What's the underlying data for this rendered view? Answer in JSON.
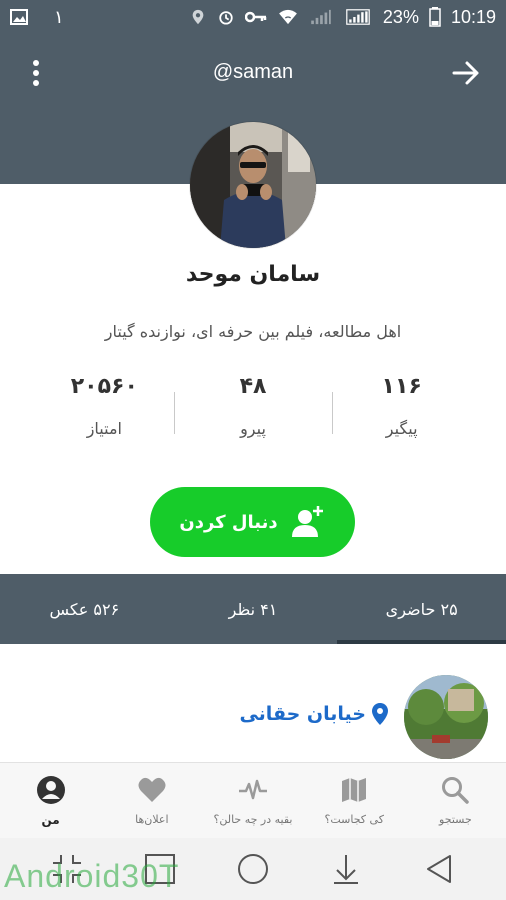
{
  "status_bar": {
    "notification_count": "١",
    "battery_percent": "23%",
    "time": "10:19",
    "icons": [
      "gallery-icon",
      "location-icon",
      "alarm-icon",
      "key-icon",
      "wifi-icon",
      "signal-icon",
      "signal-icon",
      "battery-icon"
    ]
  },
  "header": {
    "username": "@saman",
    "menu_icon": "more-vertical-icon",
    "back_icon": "arrow-right-icon"
  },
  "profile": {
    "name": "سامان موحد",
    "bio": "اهل مطالعه، فیلم بین حرفه ای، نوازنده گیتار"
  },
  "stats": [
    {
      "value": "۱۱۶",
      "label": "پیگیر"
    },
    {
      "value": "۴۸",
      "label": "پیرو"
    },
    {
      "value": "۲۰۵۶۰",
      "label": "امتیاز"
    }
  ],
  "follow_button": {
    "label": "دنبال کردن",
    "icon": "add-user-icon"
  },
  "tabs": [
    {
      "label": "۲۵ حاضری",
      "active": true
    },
    {
      "label": "۴۱ نظر",
      "active": false
    },
    {
      "label": "۵۲۶ عکس",
      "active": false
    }
  ],
  "checkin": {
    "place": "خیابان حقانی",
    "icon": "location-pin-icon"
  },
  "bottom_nav": [
    {
      "label": "من",
      "icon": "user-icon",
      "active": true
    },
    {
      "label": "اعلان‌ها",
      "icon": "heart-icon",
      "active": false
    },
    {
      "label": "بقیه در چه حالن؟",
      "icon": "activity-icon",
      "active": false
    },
    {
      "label": "کی کجاست؟",
      "icon": "map-icon",
      "active": false
    },
    {
      "label": "جستجو",
      "icon": "search-icon",
      "active": false
    }
  ],
  "system_nav": [
    "screenshot-icon",
    "recents-icon",
    "home-icon",
    "notifications-pull-icon",
    "back-icon"
  ],
  "watermark": "Android30T",
  "colors": {
    "header": "#4f5d68",
    "follow": "#17cc2a",
    "link": "#1d6ac9"
  }
}
